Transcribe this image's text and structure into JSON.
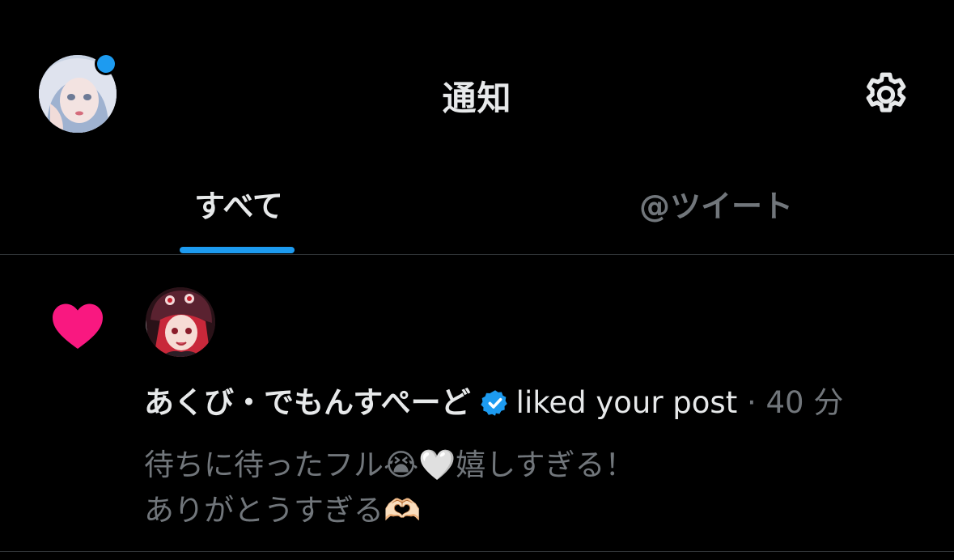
{
  "header": {
    "title": "通知"
  },
  "tabs": [
    {
      "label": "すべて",
      "active": true
    },
    {
      "label": "@ツイート",
      "active": false
    }
  ],
  "notification": {
    "type": "like",
    "user_name": "あくび・でもんすぺーど",
    "verified": true,
    "action": "liked your post",
    "separator": "·",
    "time": "40 分",
    "post_lines": [
      "待ちに待ったフル😭🤍嬉しすぎる！",
      "ありがとうすぎる🫶🏻"
    ]
  },
  "colors": {
    "background": "#000000",
    "accent": "#1d9bf0",
    "like": "#f91880",
    "text_primary": "#e7e9ea",
    "text_secondary": "#71767b",
    "divider": "#2f3336"
  },
  "icons": {
    "settings": "gear-icon",
    "like": "heart-icon",
    "verified": "verified-badge-icon"
  }
}
